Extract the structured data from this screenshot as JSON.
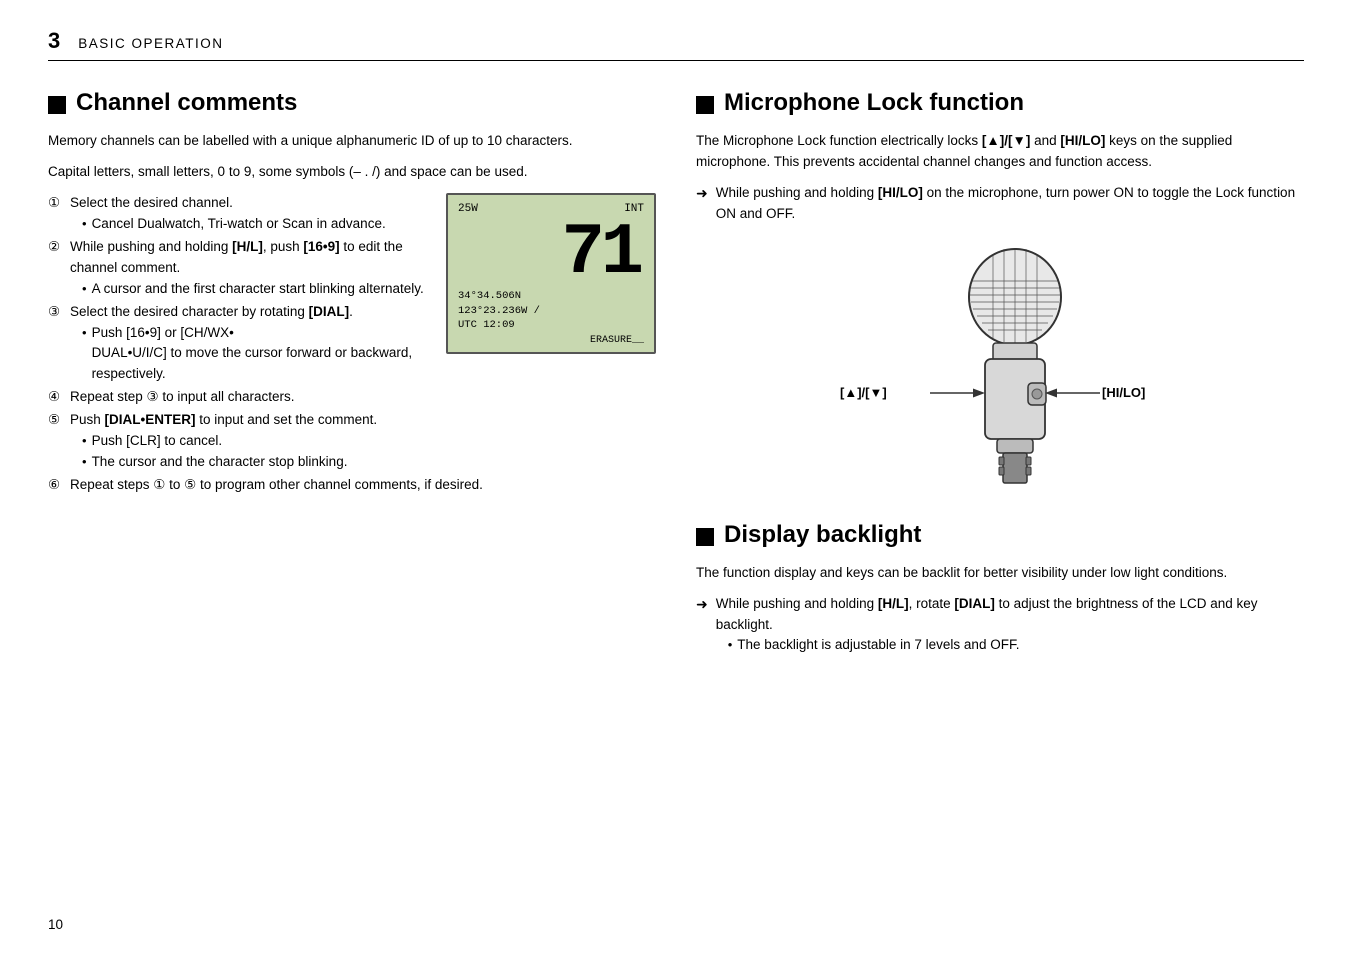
{
  "header": {
    "number": "3",
    "title": "BASIC OPERATION"
  },
  "page_number": "10",
  "channel_comments": {
    "section_title": "Channel comments",
    "para1": "Memory channels can be labelled with a unique alphanumeric ID of up to 10 characters.",
    "para2": "Capital letters, small letters, 0 to 9, some symbols (– . /) and space can be used.",
    "steps": [
      {
        "num": "①",
        "text": "Select the desired channel.",
        "sub": [
          "Cancel Dualwatch, Tri-watch or Scan in advance."
        ]
      },
      {
        "num": "②",
        "text_parts": [
          "While pushing and holding ",
          "[H/L]",
          ", push ",
          "[16•9]",
          " to edit the channel comment."
        ],
        "sub": [
          "A cursor and the first character start blinking alternately."
        ]
      },
      {
        "num": "③",
        "text_parts": [
          "Select the desired character by rotating ",
          "[DIAL]",
          "."
        ],
        "sub": [
          "Push  [16•9]  or  [CH/WX•DUAL•U/I/C]  to  move  the cursor forward or backward, respectively."
        ]
      },
      {
        "num": "④",
        "text": "Repeat step ③ to input all characters."
      },
      {
        "num": "⑤",
        "text_parts": [
          "Push ",
          "[DIAL•ENTER]",
          " to input and set the comment."
        ],
        "sub": [
          "Push [CLR] to cancel.",
          "The cursor and the character stop blinking."
        ]
      },
      {
        "num": "⑥",
        "text": "Repeat steps ① to ⑤ to program other channel comments, if desired."
      }
    ],
    "lcd": {
      "watts": "25W",
      "mode": "INT",
      "channel": "71",
      "coord1": "34°34.506N",
      "coord2": "123°23.236W /",
      "utc": "UTC 12:09",
      "bottom": "ERASURE__"
    }
  },
  "microphone_lock": {
    "section_title": "Microphone Lock function",
    "para1_parts": [
      "The Microphone Lock function electrically locks ",
      "[▲]/[▼]",
      " and ",
      "[HI/LO]",
      " keys on the supplied microphone. This prevents accidental channel changes and function access."
    ],
    "arrow_text_parts": [
      "While pushing and holding ",
      "[HI/LO]",
      " on the microphone, turn power ON to toggle the Lock function ON and OFF."
    ],
    "label_left": "[▲]/[▼]",
    "label_right": "[HI/LO]"
  },
  "display_backlight": {
    "section_title": "Display backlight",
    "para1": "The function display and keys can be backlit for better visibility under low light conditions.",
    "arrow_text_parts": [
      "While pushing and holding ",
      "[H/L]",
      ", rotate ",
      "[DIAL]",
      " to adjust the brightness of the LCD and key backlight."
    ],
    "sub": [
      "The backlight is adjustable in 7 levels and OFF."
    ]
  }
}
